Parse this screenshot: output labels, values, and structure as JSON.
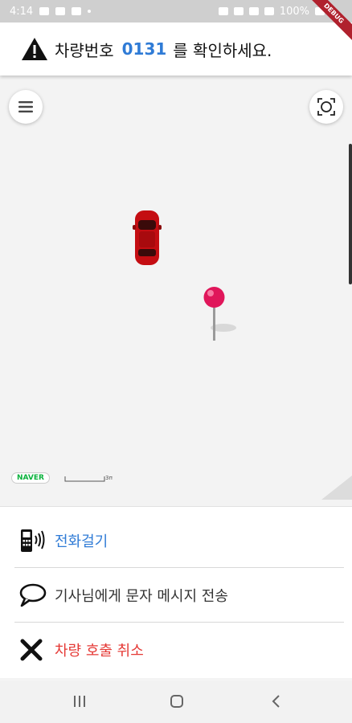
{
  "status_bar": {
    "time": "4:14",
    "battery": "100%"
  },
  "banner": {
    "prefix": "차량번호",
    "vehicle_number": "0131",
    "suffix": "를 확인하세요.",
    "icon": "warning-icon"
  },
  "map": {
    "provider_logo": "NAVER",
    "scale_label": "3m",
    "markers": [
      "car-icon",
      "pin-icon"
    ]
  },
  "actions": {
    "call_label": "전화걸기",
    "message_label": "기사님에게 문자 메시지 전송",
    "cancel_label": "차량 호출 취소"
  },
  "colors": {
    "accent_blue": "#2f7bd6",
    "danger_red": "#e53935",
    "pin": "#e0165a",
    "car": "#c40d12"
  },
  "debug_ribbon": "DEBUG"
}
